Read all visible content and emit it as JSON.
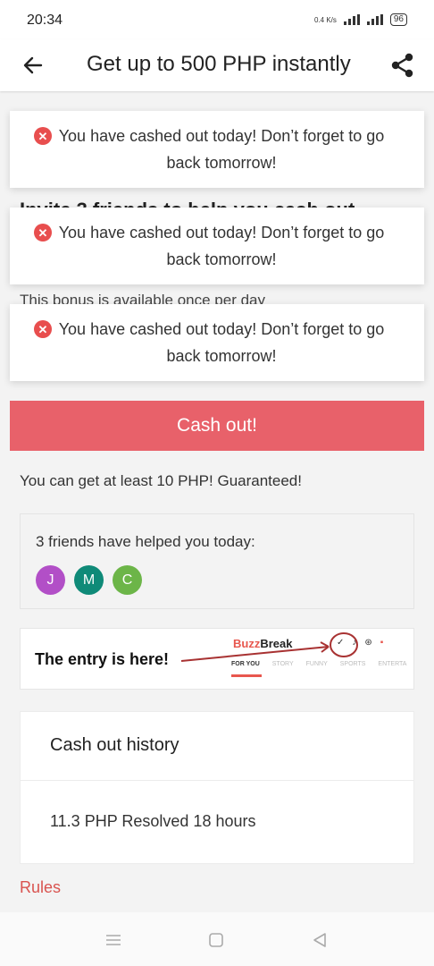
{
  "status": {
    "time": "20:34",
    "network": "0.4 K/s",
    "battery": "96"
  },
  "header": {
    "title": "Get up to 500 PHP instantly"
  },
  "background_text": {
    "heading": "Invite 3 friends to help you cash out",
    "bonus_note": "This bonus is available once per day"
  },
  "toasts": [
    {
      "line1": "You have cashed out today! Don’t forget to go",
      "line2": "back tomorrow!"
    },
    {
      "line1": "You have cashed out today! Don’t forget to go",
      "line2": "back tomorrow!"
    },
    {
      "line1": "You have cashed out today! Don’t forget to go",
      "line2": "back tomorrow!"
    }
  ],
  "cashout_button": {
    "label": "Cash out!"
  },
  "guarantee_text": "You can get at least 10 PHP! Guaranteed!",
  "friends": {
    "title": "3 friends have helped you today:",
    "avatars": [
      {
        "letter": "J",
        "color": "#b24fc7"
      },
      {
        "letter": "M",
        "color": "#0f8a78"
      },
      {
        "letter": "C",
        "color": "#6cb548"
      }
    ]
  },
  "entry": {
    "text": "The entry is here!",
    "logo_buzz": "Buzz",
    "logo_break": "Break",
    "tabs": [
      "FOR YOU",
      "STORY",
      "FUNNY",
      "SPORTS",
      "ENTERTA"
    ]
  },
  "history": {
    "title": "Cash out history",
    "items": [
      {
        "text": "11.3 PHP Resolved 18 hours"
      }
    ]
  },
  "rules": {
    "label": "Rules"
  },
  "colors": {
    "accent": "#e8616a",
    "error": "#e84e4e",
    "rules": "#d9534f"
  }
}
